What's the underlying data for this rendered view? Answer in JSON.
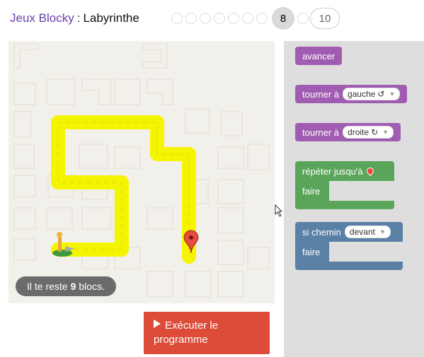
{
  "header": {
    "game_title": "Jeux Blocky",
    "separator": ":",
    "level_title": "Labyrinthe",
    "current_level": "8",
    "last_level": "10"
  },
  "maze": {
    "blocks_left_prefix": "Il te reste",
    "blocks_left_count": "9",
    "blocks_left_suffix": "blocs."
  },
  "run_button": {
    "label": "Exécuter le programme"
  },
  "toolbox": {
    "move_forward": "avancer",
    "turn_left_label": "tourner à",
    "turn_left_value": "gauche",
    "turn_right_label": "tourner à",
    "turn_right_value": "droite",
    "repeat_label": "répéter jusqu'à",
    "repeat_do": "faire",
    "if_label": "si chemin",
    "if_value": "devant",
    "if_do": "faire"
  },
  "colors": {
    "movement_block": "#a05cb0",
    "loop_block": "#5ba55b",
    "logic_block": "#5b80a5",
    "run_button": "#dd4b39",
    "path": "#f5f500"
  }
}
